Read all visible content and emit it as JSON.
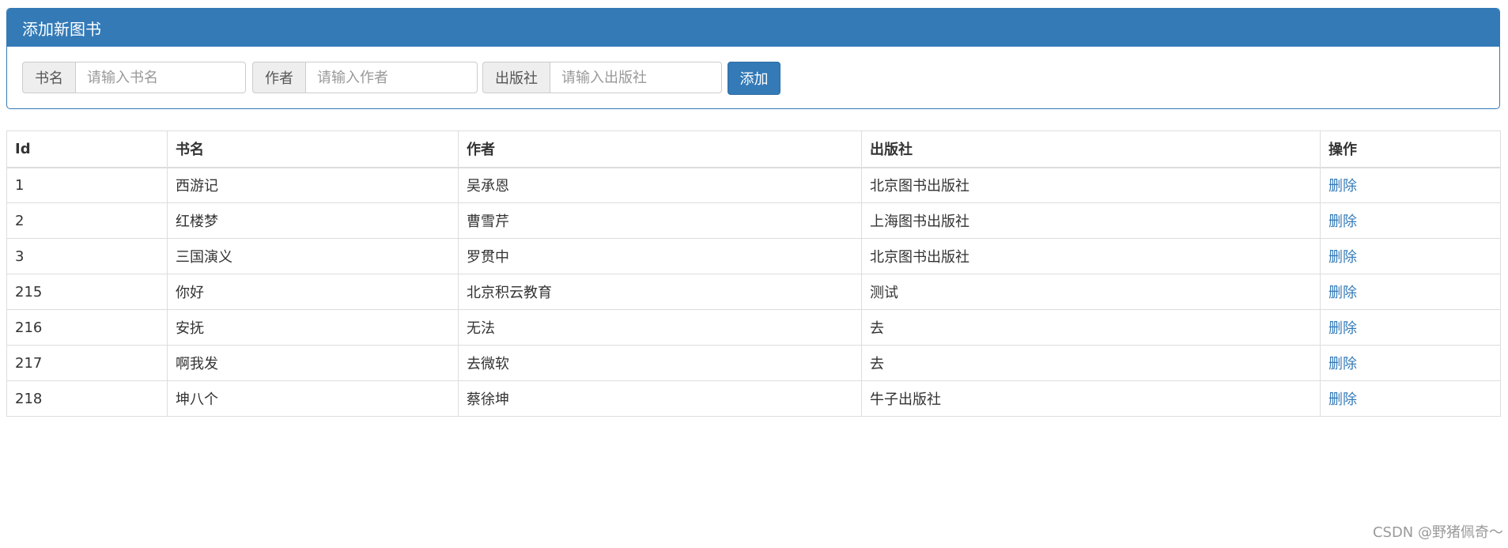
{
  "panel": {
    "title": "添加新图书",
    "fields": {
      "name": {
        "label": "书名",
        "placeholder": "请输入书名",
        "value": ""
      },
      "author": {
        "label": "作者",
        "placeholder": "请输入作者",
        "value": ""
      },
      "publisher": {
        "label": "出版社",
        "placeholder": "请输入出版社",
        "value": ""
      }
    },
    "add_label": "添加"
  },
  "colors": {
    "primary": "#337ab7",
    "border": "#dddddd",
    "addon_bg": "#eeeeee"
  },
  "table": {
    "headers": {
      "id": "Id",
      "name": "书名",
      "author": "作者",
      "publisher": "出版社",
      "action": "操作"
    },
    "rows": [
      {
        "id": "1",
        "name": "西游记",
        "author": "吴承恩",
        "publisher": "北京图书出版社",
        "action": "删除"
      },
      {
        "id": "2",
        "name": "红楼梦",
        "author": "曹雪芹",
        "publisher": "上海图书出版社",
        "action": "删除"
      },
      {
        "id": "3",
        "name": "三国演义",
        "author": "罗贯中",
        "publisher": "北京图书出版社",
        "action": "删除"
      },
      {
        "id": "215",
        "name": "你好",
        "author": "北京积云教育",
        "publisher": "测试",
        "action": "删除"
      },
      {
        "id": "216",
        "name": "安抚",
        "author": "无法",
        "publisher": "去",
        "action": "删除"
      },
      {
        "id": "217",
        "name": "啊我发",
        "author": "去微软",
        "publisher": "去",
        "action": "删除"
      },
      {
        "id": "218",
        "name": "坤八个",
        "author": "蔡徐坤",
        "publisher": "牛子出版社",
        "action": "删除"
      }
    ]
  },
  "watermark": "CSDN @野猪佩奇～"
}
